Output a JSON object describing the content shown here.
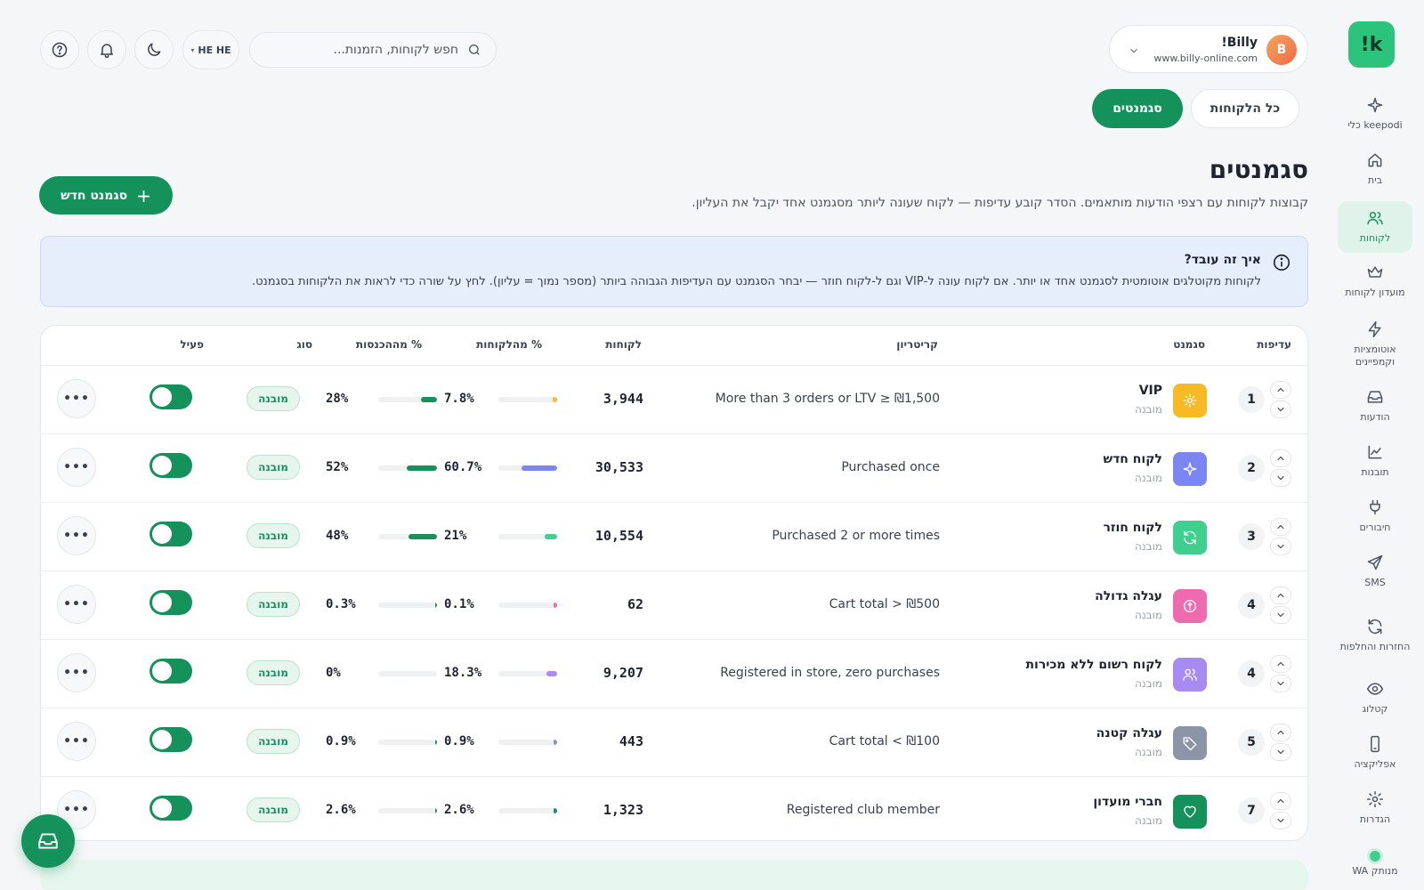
{
  "brand": {
    "logo_text": "!k",
    "accent": "#15925b"
  },
  "account": {
    "name": "!Billy",
    "url": "www.billy-online.com",
    "avatar_letter": "B"
  },
  "search": {
    "placeholder": "חפש לקוחות, הזמנות..."
  },
  "lang": {
    "label": "HE HE"
  },
  "sidebar": {
    "items": [
      {
        "label": "כלי keepodi",
        "icon": "sparkle-icon"
      },
      {
        "label": "בית",
        "icon": "home-icon"
      },
      {
        "label": "לקוחות",
        "icon": "users-icon",
        "active": true
      },
      {
        "label": "מועדון לקוחות",
        "icon": "crown-icon"
      },
      {
        "label": "אוטומציות וקמפיינים",
        "icon": "bolt-icon"
      },
      {
        "label": "הודעות",
        "icon": "inbox-icon"
      },
      {
        "label": "תובנות",
        "icon": "chart-icon"
      },
      {
        "label": "חיבורים",
        "icon": "plug-icon"
      },
      {
        "label": "SMS",
        "icon": "send-icon"
      },
      {
        "label": "החזרות והחלפות",
        "icon": "refresh-icon"
      },
      {
        "label": "קטלוג",
        "icon": "eye-icon"
      },
      {
        "label": "אפליקציה",
        "icon": "phone-icon"
      },
      {
        "label": "הגדרות",
        "icon": "gear-icon"
      }
    ],
    "wa_status": "WA מנותק"
  },
  "tabs": {
    "all": "כל הלקוחות",
    "segments": "סגמנטים"
  },
  "page": {
    "title": "סגמנטים",
    "subtitle": "קבוצות לקוחות עם רצפי הודעות מותאמים. הסדר קובע עדיפות — לקוח שעונה ליותר מסגמנט אחד יקבל את העליון.",
    "new_button": "סגמנט חדש"
  },
  "info": {
    "title": "איך זה עובד?",
    "text": "לקוחות מקוטלגים אוטומטית לסגמנט אחד או יותר. אם לקוח עונה ל-VIP וגם ל-לקוח חוזר — יבחר הסגמנט עם העדיפות הגבוהה ביותר (מספר נמוך = עליון). לחץ על שורה כדי לראות את הלקוחות בסגמנט."
  },
  "table": {
    "headers": {
      "priority": "עדיפות",
      "segment": "סגמנט",
      "criteria": "קריטריון",
      "customers": "לקוחות",
      "pct_customers": "% מהלקוחות",
      "pct_revenue": "% מההכנסות",
      "type": "סוג",
      "active": "פעיל"
    },
    "rows": [
      {
        "priority": "1",
        "name": "VIP",
        "type_sub": "מובנה",
        "icon": "sun-icon",
        "icon_color": "#f7b924",
        "criteria": "More than 3 orders or LTV ≥ ₪1,500",
        "customers": "3,944",
        "pct_customers": "7.8%",
        "pct_customers_value": 7.8,
        "pct_customers_color": "#f7b924",
        "pct_revenue": "28%",
        "pct_revenue_value": 28,
        "badge": "מובנה",
        "active": true
      },
      {
        "priority": "2",
        "name": "לקוח חדש",
        "type_sub": "מובנה",
        "icon": "sparkle-icon",
        "icon_color": "#7b86f2",
        "criteria": "Purchased once",
        "customers": "30,533",
        "pct_customers": "60.7%",
        "pct_customers_value": 60.7,
        "pct_customers_color": "#7b86f2",
        "pct_revenue": "52%",
        "pct_revenue_value": 52,
        "badge": "מובנה",
        "active": true
      },
      {
        "priority": "3",
        "name": "לקוח חוזר",
        "type_sub": "מובנה",
        "icon": "refresh-icon",
        "icon_color": "#3fcf8e",
        "criteria": "Purchased 2 or more times",
        "customers": "10,554",
        "pct_customers": "21%",
        "pct_customers_value": 21,
        "pct_customers_color": "#3fcf8e",
        "pct_revenue": "48%",
        "pct_revenue_value": 48,
        "badge": "מובנה",
        "active": true
      },
      {
        "priority": "4",
        "name": "עגלה גדולה",
        "type_sub": "מובנה",
        "icon": "coin-icon",
        "icon_color": "#ef6bb0",
        "criteria": "Cart total > ₪500",
        "customers": "62",
        "pct_customers": "0.1%",
        "pct_customers_value": 0.1,
        "pct_customers_color": "#ef6bb0",
        "pct_revenue": "0.3%",
        "pct_revenue_value": 0.3,
        "badge": "מובנה",
        "active": true
      },
      {
        "priority": "4",
        "name": "לקוח רשום ללא מכירות",
        "type_sub": "מובנה",
        "icon": "users-icon",
        "icon_color": "#a88bf2",
        "criteria": "Registered in store, zero purchases",
        "customers": "9,207",
        "pct_customers": "18.3%",
        "pct_customers_value": 18.3,
        "pct_customers_color": "#a88bf2",
        "pct_revenue": "0%",
        "pct_revenue_value": 0,
        "badge": "מובנה",
        "active": true
      },
      {
        "priority": "5",
        "name": "עגלה קטנה",
        "type_sub": "מובנה",
        "icon": "tag-icon",
        "icon_color": "#8b95a7",
        "criteria": "Cart total < ₪100",
        "customers": "443",
        "pct_customers": "0.9%",
        "pct_customers_value": 0.9,
        "pct_customers_color": "#8b95a7",
        "pct_revenue": "0.9%",
        "pct_revenue_value": 0.9,
        "badge": "מובנה",
        "active": true
      },
      {
        "priority": "7",
        "name": "חברי מועדון",
        "type_sub": "מובנה",
        "icon": "heart-icon",
        "icon_color": "#15925b",
        "criteria": "Registered club member",
        "customers": "1,323",
        "pct_customers": "2.6%",
        "pct_customers_value": 2.6,
        "pct_customers_color": "#15925b",
        "pct_revenue": "2.6%",
        "pct_revenue_value": 2.6,
        "badge": "מובנה",
        "active": true
      }
    ],
    "more_label": "•••"
  }
}
